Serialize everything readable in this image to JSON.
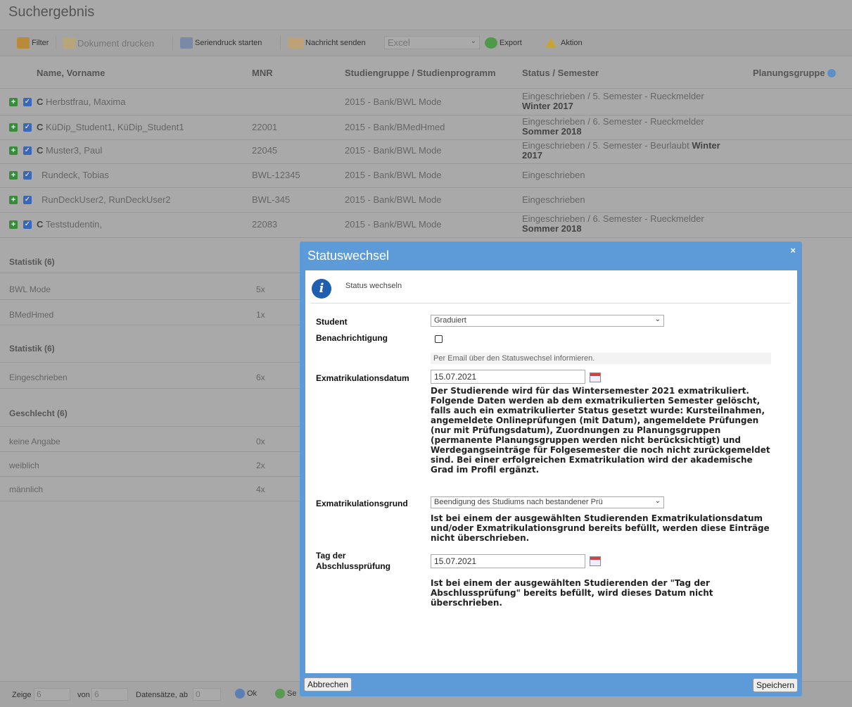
{
  "page": {
    "title": "Suchergebnis"
  },
  "toolbar": {
    "filter": "Filter",
    "print": "Dokument drucken",
    "serial": "Seriendruck starten",
    "message": "Nachricht senden",
    "format": "Excel",
    "export": "Export",
    "actions": "Aktion"
  },
  "table": {
    "headers": {
      "name": "Name, Vorname",
      "mnr": "MNR",
      "group": "Studiengruppe / Studienprogramm",
      "status": "Status / Semester",
      "plan": "Planungsgruppe"
    },
    "rows": [
      {
        "flag": "C",
        "name": "Herbstfrau, Maxima",
        "mnr": "",
        "group": "2015 - Bank/BWL Mode",
        "status": "Eingeschrieben / 5. Semester - Rueckmelder",
        "semester": "Winter 2017"
      },
      {
        "flag": "C",
        "name": "KüDip_Student1, KüDip_Student1",
        "mnr": "22001",
        "group": "2015 - Bank/BMedHmed",
        "status": "Eingeschrieben / 6. Semester - Rueckmelder",
        "semester": "Sommer 2018"
      },
      {
        "flag": "C",
        "name": "Muster3, Paul",
        "mnr": "22045",
        "group": "2015 - Bank/BWL Mode",
        "status": "Eingeschrieben / 5. Semester - Beurlaubt",
        "status_b": "Winter",
        "semester": "2017"
      },
      {
        "flag": "",
        "name": "Rundeck, Tobias",
        "mnr": "BWL-12345",
        "group": "2015 - Bank/BWL Mode",
        "status": "Eingeschrieben",
        "semester": ""
      },
      {
        "flag": "",
        "name": "RunDeckUser2, RunDeckUser2",
        "mnr": "BWL-345",
        "group": "2015 - Bank/BWL Mode",
        "status": "Eingeschrieben",
        "semester": ""
      },
      {
        "flag": "C",
        "name": "Teststudentin,",
        "mnr": "22083",
        "group": "2015 - Bank/BWL Mode",
        "status": "Eingeschrieben / 6. Semester - Rueckmelder",
        "semester": "Sommer 2018"
      }
    ]
  },
  "stats": {
    "s1": {
      "title": "Statistik (6)",
      "items": [
        {
          "label": "BWL Mode",
          "value": "5x"
        },
        {
          "label": "BMedHmed",
          "value": "1x"
        }
      ]
    },
    "s2": {
      "title": "Statistik (6)",
      "items": [
        {
          "label": "Eingeschrieben",
          "value": "6x"
        }
      ]
    },
    "s3": {
      "title": "Geschlecht (6)",
      "items": [
        {
          "label": "keine Angabe",
          "value": "0x"
        },
        {
          "label": "weiblich",
          "value": "2x"
        },
        {
          "label": "männlich",
          "value": "4x"
        }
      ]
    }
  },
  "footer": {
    "show": "Zeige",
    "show_val": "6",
    "of": "von",
    "of_val": "6",
    "records": "Datensätze, ab",
    "records_val": "0",
    "ok": "Ok",
    "cut": "Se"
  },
  "dialog": {
    "title": "Statuswechsel",
    "close": "×",
    "info": "Status wechseln",
    "student_label": "Student",
    "student_value": "Graduiert",
    "notify_label": "Benachrichtigung",
    "notify_hint": "Per Email über den Statuswechsel informieren.",
    "exdate_label": "Exmatrikulationsdatum",
    "exdate_value": "15.07.2021",
    "exdate_text": [
      "Der Studierende wird für das Wintersemester 2021 exmatrikuliert.",
      "Folgende Daten werden ab dem exmatrikulierten Semester gelöscht,",
      "falls auch ein exmatrikulierter Status gesetzt wurde: Kursteilnahmen,",
      "angemeldete Onlineprüfungen (mit Datum), angemeldete Prüfungen",
      "(nur mit Prüfungsdatum), Zuordnungen zu Planungsgruppen",
      "(permanente Planungsgruppen werden nicht berücksichtigt) und",
      "Werdegangseinträge für Folgesemester die noch nicht zurückgemeldet",
      "sind. Bei einer erfolgreichen Exmatrikulation wird der akademische",
      "Grad im Profil ergänzt."
    ],
    "reason_label": "Exmatrikulationsgrund",
    "reason_value": "Beendigung des Studiums nach bestandener Prü",
    "reason_text": [
      "Ist bei einem der ausgewählten Studierenden Exmatrikulationsdatum",
      "und/oder Exmatrikulationsgrund bereits befüllt, werden diese Einträge",
      "nicht überschrieben."
    ],
    "exam_label_1": "Tag der",
    "exam_label_2": "Abschlussprüfung",
    "exam_value": "15.07.2021",
    "exam_text": [
      "Ist bei einem der ausgewählten Studierenden der \"Tag der",
      "Abschlussprüfung\" bereits befüllt, wird dieses Datum nicht",
      "überschrieben."
    ],
    "cancel": "Abbrechen",
    "save": "Speichern"
  }
}
